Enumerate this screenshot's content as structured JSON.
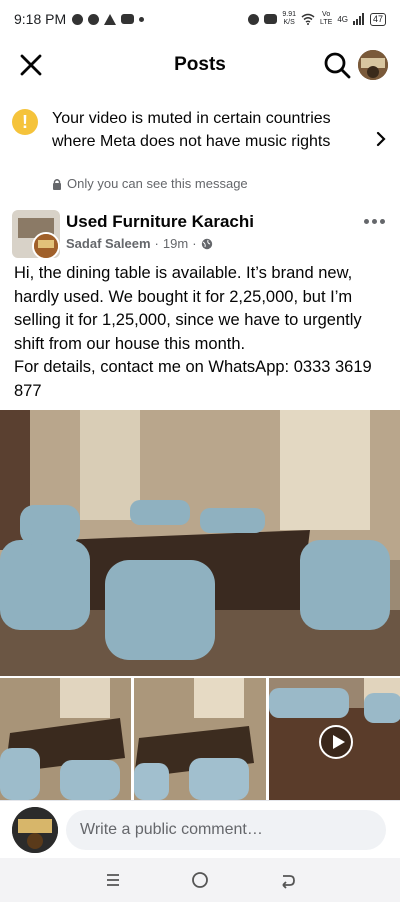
{
  "status_bar": {
    "time": "9:18 PM",
    "network_speed": "9.91\nK/S",
    "volte": "Vo\nLTE",
    "signal": "4G",
    "battery": "47"
  },
  "header": {
    "title": "Posts"
  },
  "notice": {
    "text": "Your video is muted in certain countries where Meta does not have music rights",
    "visibility": "Only you can see this message"
  },
  "post": {
    "group_name": "Used Furniture Karachi",
    "author": "Sadaf Saleem",
    "time": "19m",
    "body": "Hi, the dining table is available. It’s brand new, hardly used. We bought it for 2,25,000, but I’m selling it for 1,25,000, since we have to urgently shift from our house this month.\nFor details, contact me on WhatsApp: 0333 3619 877"
  },
  "comment": {
    "placeholder": "Write a public comment…"
  },
  "colors": {
    "warning": "#f5c33b",
    "secondary_text": "#65676b",
    "input_bg": "#f0f2f5"
  }
}
